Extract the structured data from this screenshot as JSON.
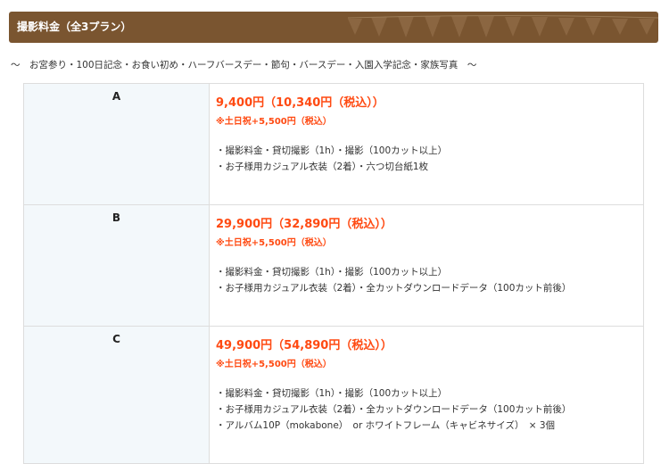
{
  "header": {
    "title": "撮影料金（全3プラン）"
  },
  "subtitle": "～　お宮参り・100日記念・お食い初め・ハーフバースデー・節句・バースデー・入園入学記念・家族写真　～",
  "plans": [
    {
      "name": "A",
      "price": "9,400円（10,340円（税込））",
      "surcharge": "※土日祝+5,500円（税込）",
      "features": [
        "・撮影料金・貸切撮影（1h）・撮影（100カット以上）",
        "・お子様用カジュアル衣装（2着）・六つ切台紙1枚"
      ]
    },
    {
      "name": "B",
      "price": "29,900円（32,890円（税込））",
      "surcharge": "※土日祝+5,500円（税込）",
      "features": [
        "・撮影料金・貸切撮影（1h）・撮影（100カット以上）",
        "・お子様用カジュアル衣装（2着）・全カットダウンロードデータ（100カット前後）"
      ]
    },
    {
      "name": "C",
      "price": "49,900円（54,890円（税込））",
      "surcharge": "※土日祝+5,500円（税込）",
      "features": [
        "・撮影料金・貸切撮影（1h）・撮影（100カット以上）",
        "・お子様用カジュアル衣装（2着）・全カットダウンロードデータ（100カット前後）",
        "・アルバム10P（mokabone）　or ホワイトフレーム（キャビネサイズ）　× 3個"
      ]
    }
  ],
  "colors": {
    "header_bg": "#7a5530",
    "price": "#ff4a12",
    "name_cell_bg": "#f3f8fb",
    "border": "#dddddd"
  }
}
